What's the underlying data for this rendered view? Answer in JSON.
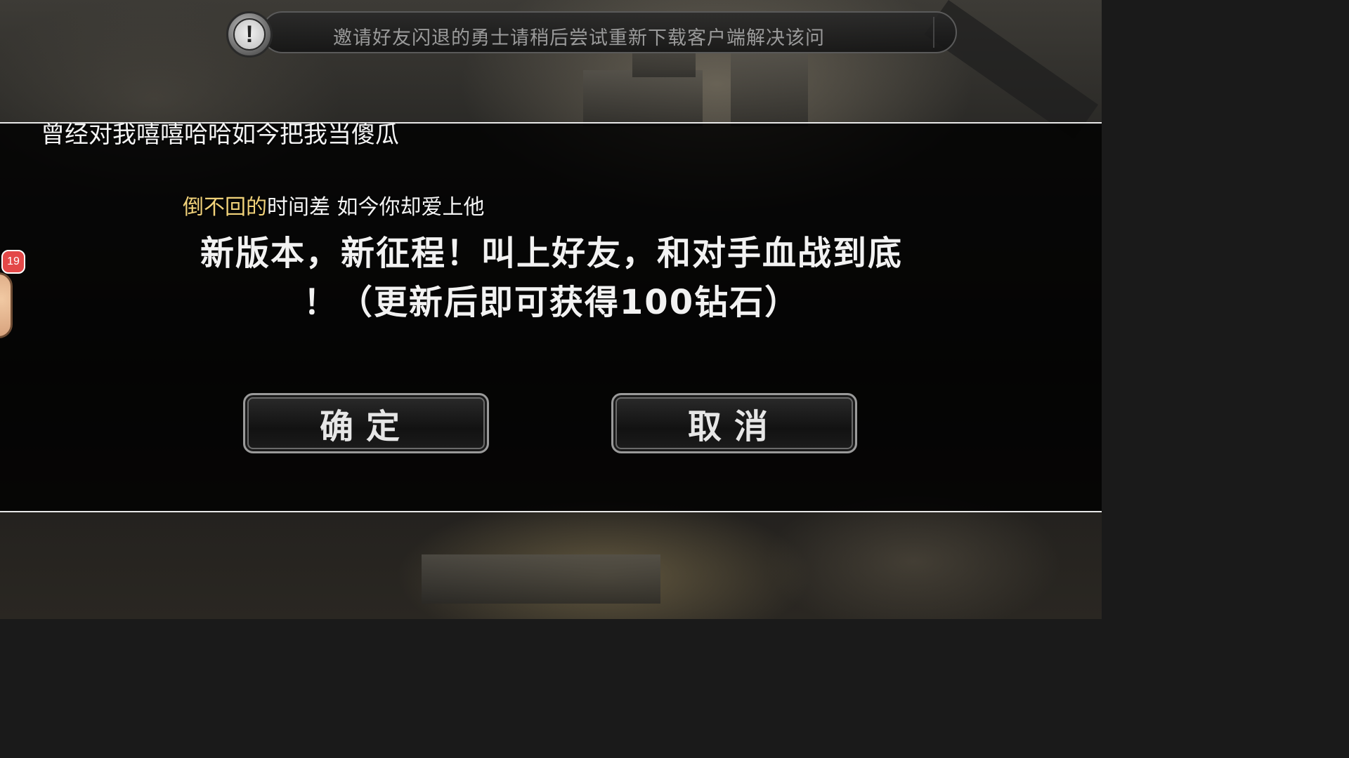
{
  "notice": {
    "icon": "exclamation-icon",
    "icon_glyph": "!",
    "text": "邀请好友闪退的勇士请稍后尝试重新下载客户端解决该问"
  },
  "lyrics": {
    "line1": "曾经对我嘻嘻哈哈如今把我当傻瓜",
    "line2_highlight": "倒不回的",
    "line2_rest": "时间差  如今你却爱上他"
  },
  "dialog": {
    "message_line1": "新版本，新征程！叫上好友，和对手血战到底",
    "message_line2": "！（更新后即可获得100钻石）",
    "confirm_label": "确定",
    "cancel_label": "取消"
  },
  "float_widget": {
    "badge_count": "19"
  },
  "colors": {
    "lyric_highlight": "#f1d27a",
    "overlay_border": "#e8e8e8",
    "badge": "#e34848"
  }
}
